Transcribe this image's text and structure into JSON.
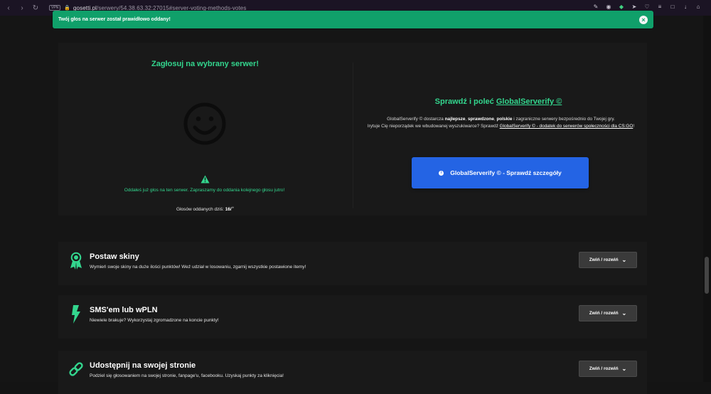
{
  "browser": {
    "url_host": "gosetti.pl",
    "url_path": "/serwery/54.38.63.32:27015#server-voting-methods-votes",
    "vpn": "VPN"
  },
  "alert": {
    "text": "Twój głos na serwer został prawidłowo oddany!"
  },
  "voting": {
    "title": "Zagłosuj na wybrany serwer!",
    "message": "Oddałeś już głos na ten serwer. Zapraszamy do oddania kolejnego głosu jutro!",
    "today_label": "Głosów oddanych dziś:",
    "today_value": "16/",
    "today_sup": "∞"
  },
  "global_serverify": {
    "title_prefix": "Sprawdź i poleć ",
    "title_link": "GlobalServerify ©",
    "desc_1": "GlobalServerify © dostarcza ",
    "desc_bold_1": "najlepsze",
    "desc_sep_1": ", ",
    "desc_bold_2": "sprawdzone",
    "desc_sep_2": ", ",
    "desc_bold_3": "polskie",
    "desc_2": " i zagraniczne serwery bezpośrednio do Twojej gry.",
    "desc_3": "Irytuje Cię nieporządek we wbudowanej wyszukiwarce? Sprawdź ",
    "desc_link": "GlobalServerify © - dodatek do serwerów społeczności dla CS:GO",
    "desc_end": "!",
    "button": "GlobalServerify © - Sprawdź szczegóły"
  },
  "features": [
    {
      "title": "Postaw skiny",
      "subtitle": "Wymień swoje skiny na duże ilości punktów! Weź udział w losowaniu, zgarnij wszystkie postawione itemy!",
      "button": "Zwiń / rozwiń",
      "icon": "award-ribbon-icon"
    },
    {
      "title": "SMS'em lub wPLN",
      "subtitle": "Niewiele brakuje? Wykorzystaj zgromadzone na koncie punkty!",
      "button": "Zwiń / rozwiń",
      "icon": "lightning-icon"
    },
    {
      "title": "Udostępnij na swojej stronie",
      "subtitle": "Podziel się głosowaniem na swojej stronie, fanpage'u, facebooku. Uzyskaj punkty za kliknięcia!",
      "button": "Zwiń / rozwiń",
      "icon": "link-icon"
    }
  ],
  "colors": {
    "accent": "#33d68e",
    "alert": "#10a06a",
    "button": "#2464e4"
  }
}
